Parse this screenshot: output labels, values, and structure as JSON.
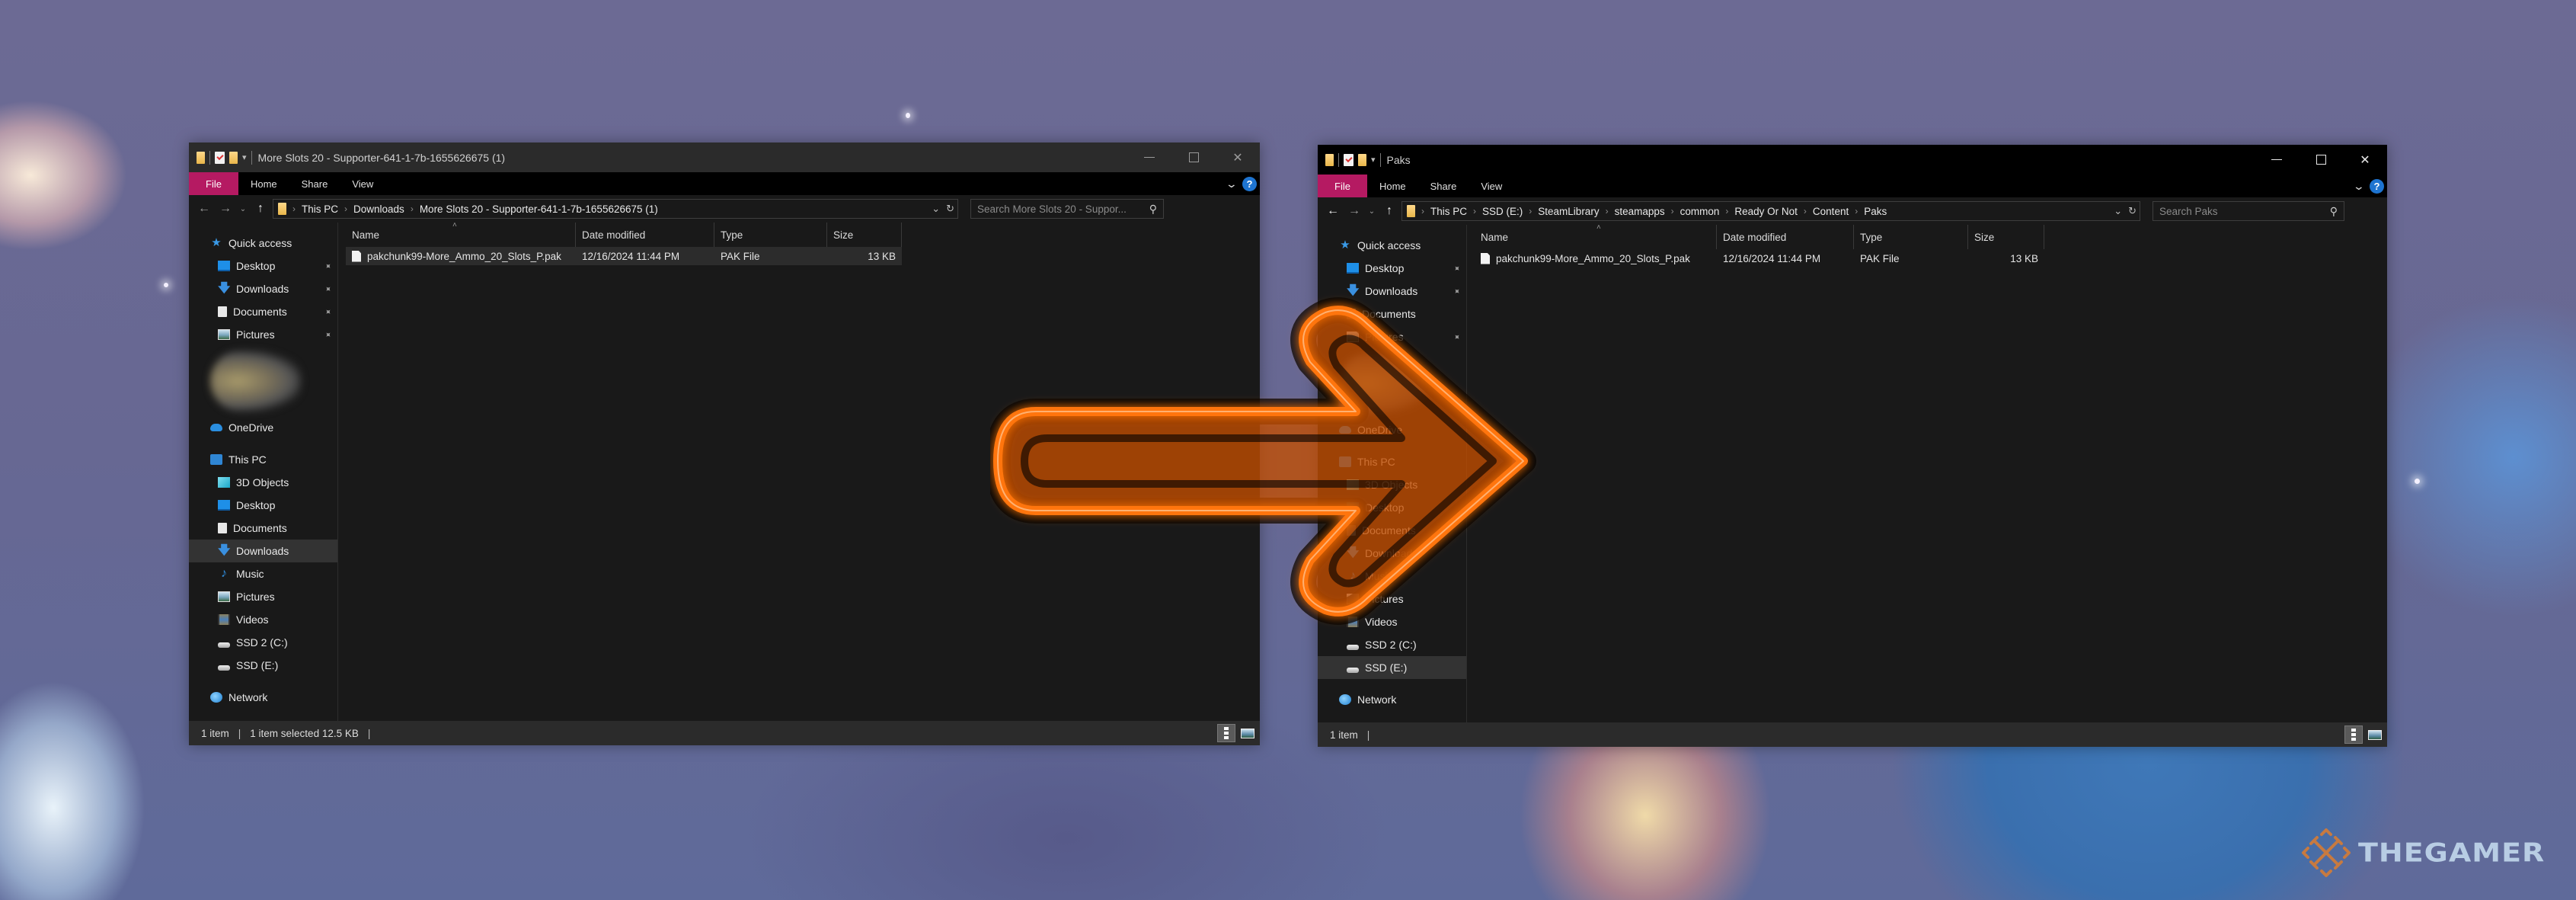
{
  "left_window": {
    "title": "More Slots 20 - Supporter-641-1-7b-1655626675 (1)",
    "ribbon_tabs": [
      "File",
      "Home",
      "Share",
      "View"
    ],
    "breadcrumb": [
      "This PC",
      "Downloads",
      "More Slots 20 - Supporter-641-1-7b-1655626675 (1)"
    ],
    "search_placeholder": "Search More Slots 20 - Suppor...",
    "nav_pane": {
      "quick_access_label": "Quick access",
      "quick_access": [
        {
          "label": "Desktop",
          "icon": "desktop-icon",
          "pinned": true
        },
        {
          "label": "Downloads",
          "icon": "download-icon",
          "pinned": true
        },
        {
          "label": "Documents",
          "icon": "documents-icon",
          "pinned": true
        },
        {
          "label": "Pictures",
          "icon": "pictures-icon",
          "pinned": true
        }
      ],
      "onedrive_label": "OneDrive",
      "this_pc_label": "This PC",
      "this_pc": [
        {
          "label": "3D Objects",
          "icon": "3d-objects-icon"
        },
        {
          "label": "Desktop",
          "icon": "desktop-icon"
        },
        {
          "label": "Documents",
          "icon": "documents-icon"
        },
        {
          "label": "Downloads",
          "icon": "download-icon",
          "selected": true
        },
        {
          "label": "Music",
          "icon": "music-icon"
        },
        {
          "label": "Pictures",
          "icon": "pictures-icon"
        },
        {
          "label": "Videos",
          "icon": "videos-icon"
        },
        {
          "label": "SSD 2 (C:)",
          "icon": "drive-icon"
        },
        {
          "label": "SSD (E:)",
          "icon": "drive-icon"
        }
      ],
      "network_label": "Network"
    },
    "columns": [
      "Name",
      "Date modified",
      "Type",
      "Size"
    ],
    "files": [
      {
        "name": "pakchunk99-More_Ammo_20_Slots_P.pak",
        "date": "12/16/2024 11:44 PM",
        "type": "PAK File",
        "size": "13 KB",
        "selected": true
      }
    ],
    "status": {
      "count": "1 item",
      "selection": "1 item selected  12.5 KB"
    }
  },
  "right_window": {
    "title": "Paks",
    "ribbon_tabs": [
      "File",
      "Home",
      "Share",
      "View"
    ],
    "breadcrumb": [
      "This PC",
      "SSD (E:)",
      "SteamLibrary",
      "steamapps",
      "common",
      "Ready Or Not",
      "Content",
      "Paks"
    ],
    "search_placeholder": "Search Paks",
    "nav_pane": {
      "quick_access_label": "Quick access",
      "quick_access": [
        {
          "label": "Desktop",
          "icon": "desktop-icon",
          "pinned": true
        },
        {
          "label": "Downloads",
          "icon": "download-icon",
          "pinned": true
        },
        {
          "label": "Documents",
          "icon": "documents-icon",
          "pinned": false
        },
        {
          "label": "Pictures",
          "icon": "pictures-icon",
          "pinned": true
        }
      ],
      "onedrive_label": "OneDrive",
      "this_pc_label": "This PC",
      "this_pc": [
        {
          "label": "3D Objects",
          "icon": "3d-objects-icon"
        },
        {
          "label": "Desktop",
          "icon": "desktop-icon"
        },
        {
          "label": "Documents",
          "icon": "documents-icon"
        },
        {
          "label": "Downloads",
          "icon": "download-icon"
        },
        {
          "label": "Music",
          "icon": "music-icon"
        },
        {
          "label": "Pictures",
          "icon": "pictures-icon"
        },
        {
          "label": "Videos",
          "icon": "videos-icon"
        },
        {
          "label": "SSD 2 (C:)",
          "icon": "drive-icon"
        },
        {
          "label": "SSD (E:)",
          "icon": "drive-icon",
          "selected": true
        }
      ],
      "network_label": "Network"
    },
    "columns": [
      "Name",
      "Date modified",
      "Type",
      "Size"
    ],
    "files": [
      {
        "name": "pakchunk99-More_Ammo_20_Slots_P.pak",
        "date": "12/16/2024 11:44 PM",
        "type": "PAK File",
        "size": "13 KB",
        "selected": false
      }
    ],
    "status": {
      "count": "1 item"
    }
  },
  "overlay": {
    "arrow_direction": "right",
    "arrow_color": "#ff6a00"
  },
  "watermark": {
    "text": "THEGAMER"
  },
  "colors": {
    "file_tab": "#b51a62",
    "help_badge": "#1e74d0",
    "window_bg": "#191919"
  }
}
